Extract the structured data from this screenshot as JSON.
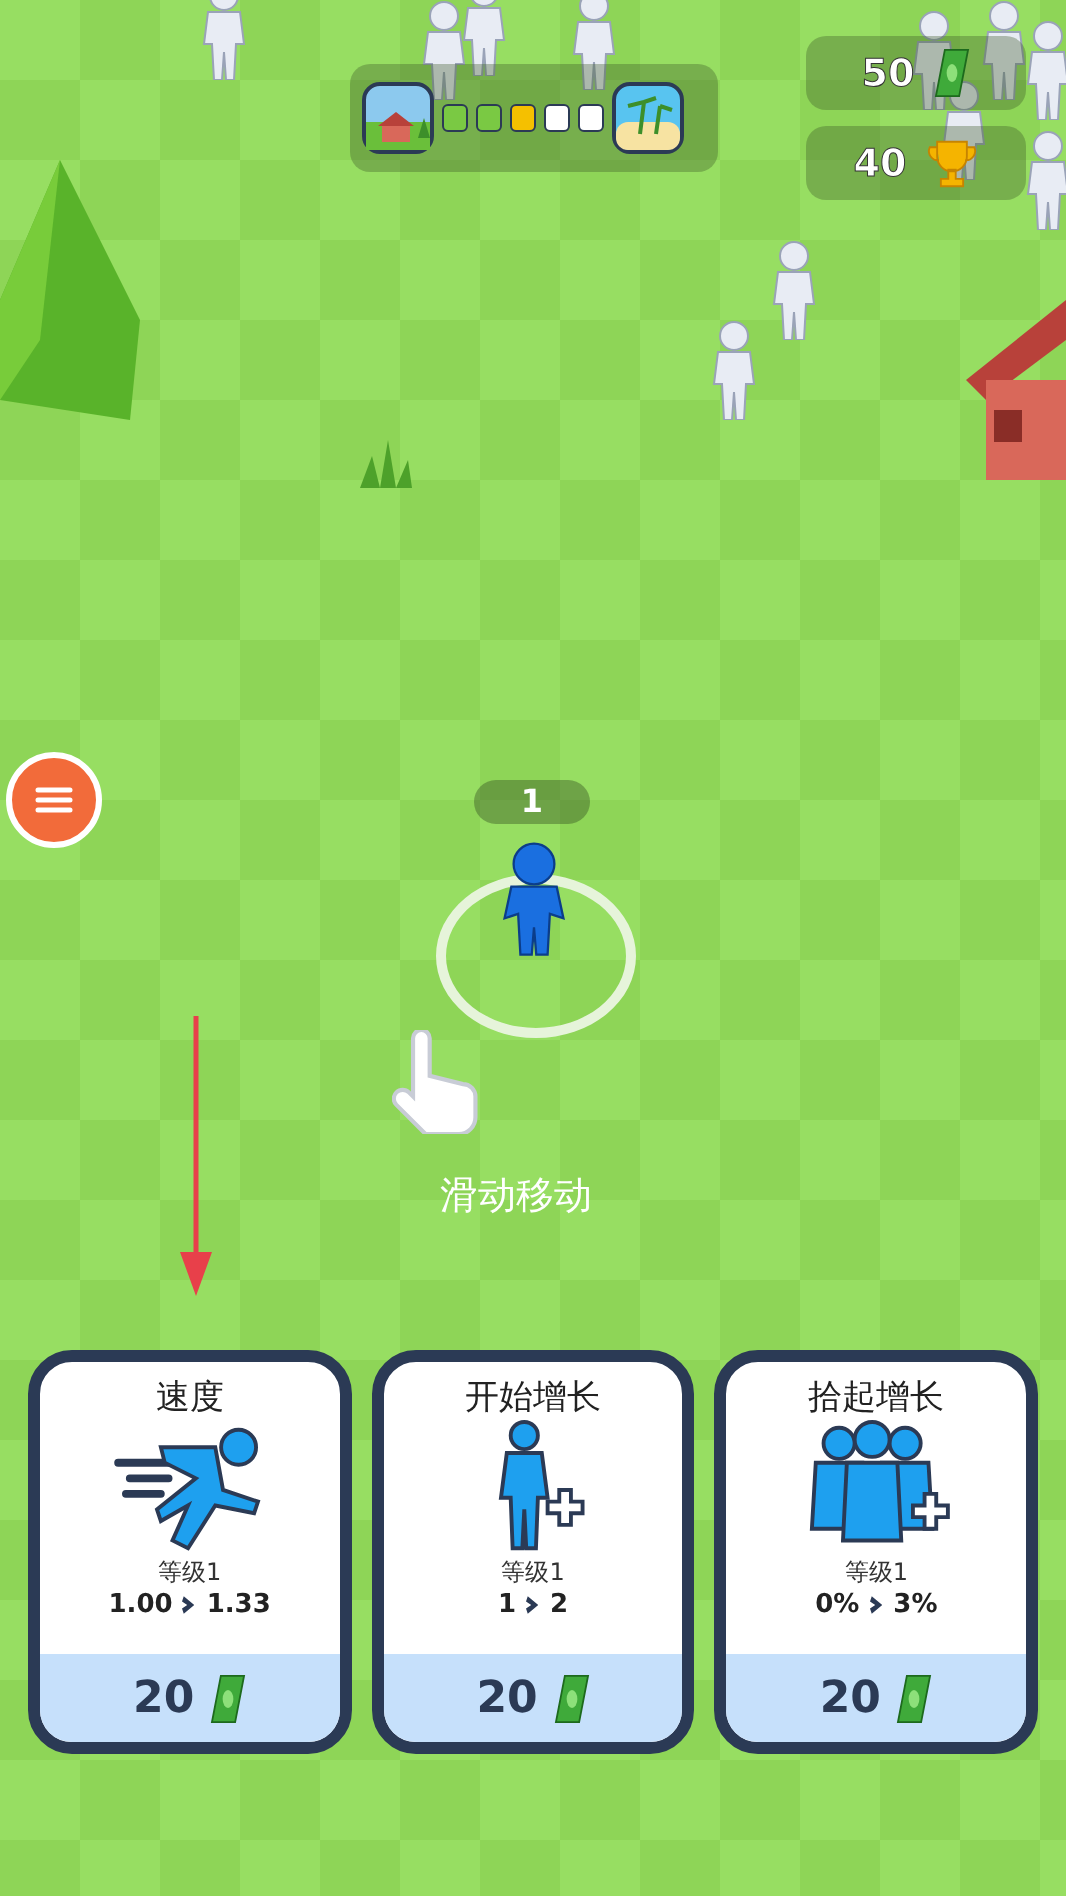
{
  "hud": {
    "progress": {
      "steps": [
        {
          "color": "#7ac943"
        },
        {
          "color": "#7ac943"
        },
        {
          "color": "#f5c000"
        },
        {
          "color": "#ffffff"
        },
        {
          "color": "#ffffff"
        }
      ]
    },
    "cash": "50",
    "trophies": "40"
  },
  "player": {
    "count": "1"
  },
  "hint": "滑动移动",
  "upgrades": [
    {
      "kind": "speed",
      "title": "速度",
      "level_label": "等级1",
      "from": "1.00",
      "to": "1.33",
      "cost": "20"
    },
    {
      "kind": "start",
      "title": "开始增长",
      "level_label": "等级1",
      "from": "1",
      "to": "2",
      "cost": "20"
    },
    {
      "kind": "pickup",
      "title": "拾起增长",
      "level_label": "等级1",
      "from": "0%",
      "to": "3%",
      "cost": "20"
    }
  ]
}
